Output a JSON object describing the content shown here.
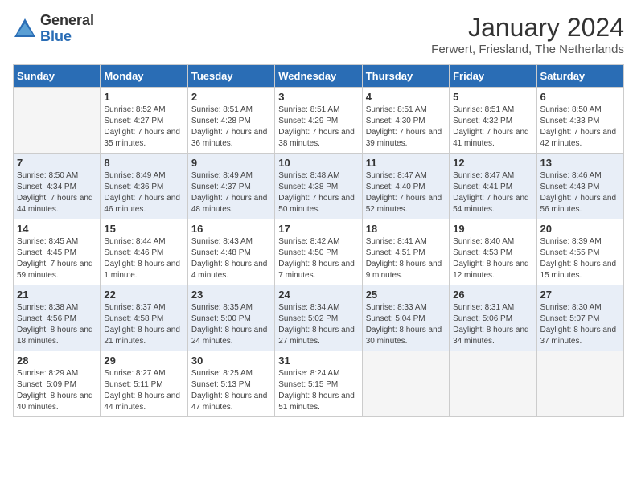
{
  "logo": {
    "general": "General",
    "blue": "Blue"
  },
  "title": "January 2024",
  "location": "Ferwert, Friesland, The Netherlands",
  "days_of_week": [
    "Sunday",
    "Monday",
    "Tuesday",
    "Wednesday",
    "Thursday",
    "Friday",
    "Saturday"
  ],
  "weeks": [
    [
      {
        "day": "",
        "sunrise": "",
        "sunset": "",
        "daylight": ""
      },
      {
        "day": "1",
        "sunrise": "Sunrise: 8:52 AM",
        "sunset": "Sunset: 4:27 PM",
        "daylight": "Daylight: 7 hours and 35 minutes."
      },
      {
        "day": "2",
        "sunrise": "Sunrise: 8:51 AM",
        "sunset": "Sunset: 4:28 PM",
        "daylight": "Daylight: 7 hours and 36 minutes."
      },
      {
        "day": "3",
        "sunrise": "Sunrise: 8:51 AM",
        "sunset": "Sunset: 4:29 PM",
        "daylight": "Daylight: 7 hours and 38 minutes."
      },
      {
        "day": "4",
        "sunrise": "Sunrise: 8:51 AM",
        "sunset": "Sunset: 4:30 PM",
        "daylight": "Daylight: 7 hours and 39 minutes."
      },
      {
        "day": "5",
        "sunrise": "Sunrise: 8:51 AM",
        "sunset": "Sunset: 4:32 PM",
        "daylight": "Daylight: 7 hours and 41 minutes."
      },
      {
        "day": "6",
        "sunrise": "Sunrise: 8:50 AM",
        "sunset": "Sunset: 4:33 PM",
        "daylight": "Daylight: 7 hours and 42 minutes."
      }
    ],
    [
      {
        "day": "7",
        "sunrise": "Sunrise: 8:50 AM",
        "sunset": "Sunset: 4:34 PM",
        "daylight": "Daylight: 7 hours and 44 minutes."
      },
      {
        "day": "8",
        "sunrise": "Sunrise: 8:49 AM",
        "sunset": "Sunset: 4:36 PM",
        "daylight": "Daylight: 7 hours and 46 minutes."
      },
      {
        "day": "9",
        "sunrise": "Sunrise: 8:49 AM",
        "sunset": "Sunset: 4:37 PM",
        "daylight": "Daylight: 7 hours and 48 minutes."
      },
      {
        "day": "10",
        "sunrise": "Sunrise: 8:48 AM",
        "sunset": "Sunset: 4:38 PM",
        "daylight": "Daylight: 7 hours and 50 minutes."
      },
      {
        "day": "11",
        "sunrise": "Sunrise: 8:47 AM",
        "sunset": "Sunset: 4:40 PM",
        "daylight": "Daylight: 7 hours and 52 minutes."
      },
      {
        "day": "12",
        "sunrise": "Sunrise: 8:47 AM",
        "sunset": "Sunset: 4:41 PM",
        "daylight": "Daylight: 7 hours and 54 minutes."
      },
      {
        "day": "13",
        "sunrise": "Sunrise: 8:46 AM",
        "sunset": "Sunset: 4:43 PM",
        "daylight": "Daylight: 7 hours and 56 minutes."
      }
    ],
    [
      {
        "day": "14",
        "sunrise": "Sunrise: 8:45 AM",
        "sunset": "Sunset: 4:45 PM",
        "daylight": "Daylight: 7 hours and 59 minutes."
      },
      {
        "day": "15",
        "sunrise": "Sunrise: 8:44 AM",
        "sunset": "Sunset: 4:46 PM",
        "daylight": "Daylight: 8 hours and 1 minute."
      },
      {
        "day": "16",
        "sunrise": "Sunrise: 8:43 AM",
        "sunset": "Sunset: 4:48 PM",
        "daylight": "Daylight: 8 hours and 4 minutes."
      },
      {
        "day": "17",
        "sunrise": "Sunrise: 8:42 AM",
        "sunset": "Sunset: 4:50 PM",
        "daylight": "Daylight: 8 hours and 7 minutes."
      },
      {
        "day": "18",
        "sunrise": "Sunrise: 8:41 AM",
        "sunset": "Sunset: 4:51 PM",
        "daylight": "Daylight: 8 hours and 9 minutes."
      },
      {
        "day": "19",
        "sunrise": "Sunrise: 8:40 AM",
        "sunset": "Sunset: 4:53 PM",
        "daylight": "Daylight: 8 hours and 12 minutes."
      },
      {
        "day": "20",
        "sunrise": "Sunrise: 8:39 AM",
        "sunset": "Sunset: 4:55 PM",
        "daylight": "Daylight: 8 hours and 15 minutes."
      }
    ],
    [
      {
        "day": "21",
        "sunrise": "Sunrise: 8:38 AM",
        "sunset": "Sunset: 4:56 PM",
        "daylight": "Daylight: 8 hours and 18 minutes."
      },
      {
        "day": "22",
        "sunrise": "Sunrise: 8:37 AM",
        "sunset": "Sunset: 4:58 PM",
        "daylight": "Daylight: 8 hours and 21 minutes."
      },
      {
        "day": "23",
        "sunrise": "Sunrise: 8:35 AM",
        "sunset": "Sunset: 5:00 PM",
        "daylight": "Daylight: 8 hours and 24 minutes."
      },
      {
        "day": "24",
        "sunrise": "Sunrise: 8:34 AM",
        "sunset": "Sunset: 5:02 PM",
        "daylight": "Daylight: 8 hours and 27 minutes."
      },
      {
        "day": "25",
        "sunrise": "Sunrise: 8:33 AM",
        "sunset": "Sunset: 5:04 PM",
        "daylight": "Daylight: 8 hours and 30 minutes."
      },
      {
        "day": "26",
        "sunrise": "Sunrise: 8:31 AM",
        "sunset": "Sunset: 5:06 PM",
        "daylight": "Daylight: 8 hours and 34 minutes."
      },
      {
        "day": "27",
        "sunrise": "Sunrise: 8:30 AM",
        "sunset": "Sunset: 5:07 PM",
        "daylight": "Daylight: 8 hours and 37 minutes."
      }
    ],
    [
      {
        "day": "28",
        "sunrise": "Sunrise: 8:29 AM",
        "sunset": "Sunset: 5:09 PM",
        "daylight": "Daylight: 8 hours and 40 minutes."
      },
      {
        "day": "29",
        "sunrise": "Sunrise: 8:27 AM",
        "sunset": "Sunset: 5:11 PM",
        "daylight": "Daylight: 8 hours and 44 minutes."
      },
      {
        "day": "30",
        "sunrise": "Sunrise: 8:25 AM",
        "sunset": "Sunset: 5:13 PM",
        "daylight": "Daylight: 8 hours and 47 minutes."
      },
      {
        "day": "31",
        "sunrise": "Sunrise: 8:24 AM",
        "sunset": "Sunset: 5:15 PM",
        "daylight": "Daylight: 8 hours and 51 minutes."
      },
      {
        "day": "",
        "sunrise": "",
        "sunset": "",
        "daylight": ""
      },
      {
        "day": "",
        "sunrise": "",
        "sunset": "",
        "daylight": ""
      },
      {
        "day": "",
        "sunrise": "",
        "sunset": "",
        "daylight": ""
      }
    ]
  ]
}
